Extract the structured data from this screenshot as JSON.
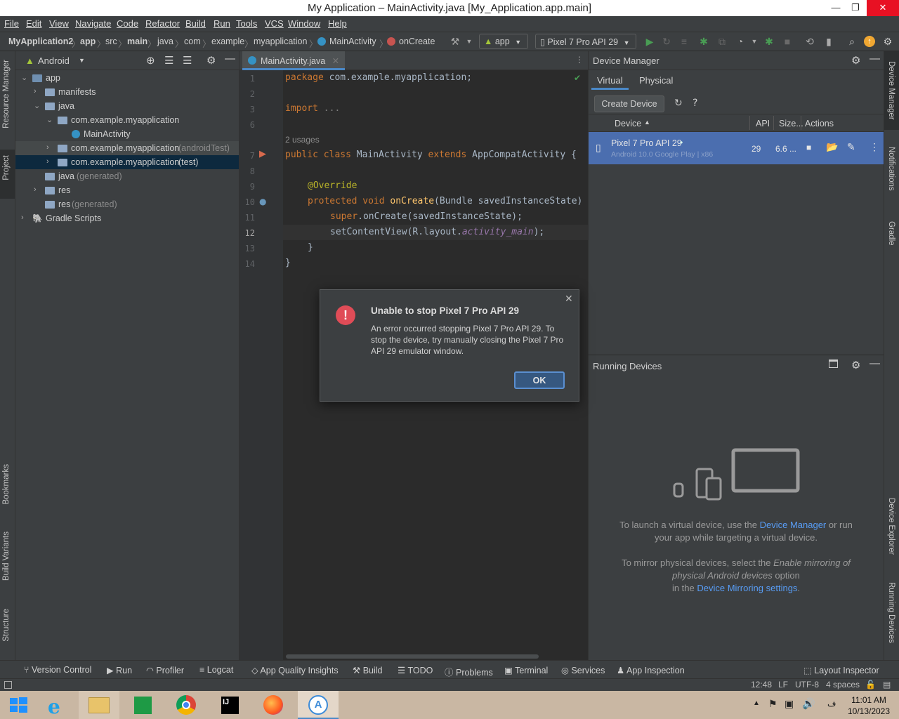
{
  "window": {
    "title": "My Application – MainActivity.java [My_Application.app.main]",
    "min": "—",
    "max": "❐",
    "close": "✕"
  },
  "menu": [
    "File",
    "Edit",
    "View",
    "Navigate",
    "Code",
    "Refactor",
    "Build",
    "Run",
    "Tools",
    "VCS",
    "Window",
    "Help"
  ],
  "breadcrumb": [
    "MyApplication2",
    "app",
    "src",
    "main",
    "java",
    "com",
    "example",
    "myapplication",
    "MainActivity",
    "onCreate"
  ],
  "toolbar": {
    "config": "app",
    "device": "Pixel 7 Pro API 29"
  },
  "left_strip": {
    "resource_manager": "Resource Manager",
    "project": "Project",
    "bookmarks": "Bookmarks",
    "build_variants": "Build Variants",
    "structure": "Structure"
  },
  "right_strip": {
    "device_manager": "Device Manager",
    "notifications": "Notifications",
    "gradle": "Gradle",
    "device_explorer": "Device Explorer",
    "running_devices": "Running Devices"
  },
  "project": {
    "view": "Android",
    "tree": [
      {
        "label": "app",
        "suffix": ""
      },
      {
        "label": "manifests",
        "suffix": ""
      },
      {
        "label": "java",
        "suffix": ""
      },
      {
        "label": "com.example.myapplication",
        "suffix": ""
      },
      {
        "label": "MainActivity",
        "suffix": ""
      },
      {
        "label": "com.example.myapplication",
        "suffix": "(androidTest)"
      },
      {
        "label": "com.example.myapplication",
        "suffix": "(test)"
      },
      {
        "label": "java",
        "suffix": "(generated)"
      },
      {
        "label": "res",
        "suffix": ""
      },
      {
        "label": "res",
        "suffix": "(generated)"
      },
      {
        "label": "Gradle Scripts",
        "suffix": ""
      }
    ]
  },
  "editor": {
    "tab": "MainActivity.java",
    "usages": "2 usages",
    "line_numbers": [
      "1",
      "2",
      "3",
      "6",
      "7",
      "8",
      "9",
      "10",
      "11",
      "12",
      "13",
      "14"
    ],
    "l1a": "package",
    "l1b": " com.example.myapplication;",
    "l3a": "import",
    "l3b": " ...",
    "l7a": "public class",
    "l7b": " MainActivity ",
    "l7c": "extends",
    "l7d": " AppCompatActivity {",
    "l9": "@Override",
    "l10a": "protected void ",
    "l10b": "onCreate",
    "l10c": "(Bundle savedInstanceState) {",
    "l11a": "super",
    "l11b": ".onCreate(savedInstanceState);",
    "l12a": "setContentView(R.layout.",
    "l12b": "activity_main",
    "l12c": ");",
    "l13": "}",
    "l14": "}"
  },
  "device_manager": {
    "title": "Device Manager",
    "tabs": [
      "Virtual",
      "Physical"
    ],
    "create_button": "Create Device",
    "help": "?",
    "columns": {
      "device": "Device",
      "api": "API",
      "size": "Size...",
      "actions": "Actions"
    },
    "row": {
      "name": "Pixel 7 Pro API 29",
      "dot": "•",
      "detail": "Android 10.0 Google Play | x86",
      "api": "29",
      "size": "6.6 ..."
    }
  },
  "running_devices": {
    "title": "Running Devices",
    "msg1_a": "To launch a virtual device, use the ",
    "msg1_link": "Device Manager",
    "msg1_b": " or run",
    "msg1_c": "your app while targeting a virtual device.",
    "msg2_a": "To mirror physical devices, select the ",
    "msg2_it1": "Enable mirroring of",
    "msg2_it2": "physical Android devices",
    "msg2_b": " option",
    "msg2_c": "in the ",
    "msg2_link": "Device Mirroring settings",
    "msg2_d": "."
  },
  "dialog": {
    "title": "Unable to stop Pixel 7 Pro API 29",
    "line1": "An error occurred stopping Pixel 7 Pro API 29. To",
    "line2": "stop the device, try manually closing the Pixel 7 Pro",
    "line3": "API 29 emulator window.",
    "ok": "OK",
    "close": "✕"
  },
  "bottom_tools": [
    "Version Control",
    "Run",
    "Profiler",
    "Logcat",
    "App Quality Insights",
    "Build",
    "TODO",
    "Problems",
    "Terminal",
    "Services",
    "App Inspection",
    "Layout Inspector"
  ],
  "status": {
    "pos": "12:48",
    "lf": "LF",
    "enc": "UTF-8",
    "indent": "4 spaces"
  },
  "clock": {
    "time": "11:01 AM",
    "date": "10/13/2023"
  },
  "colors": {
    "accent": "#4a88c7",
    "selection": "#4b6eaf",
    "error": "#e04c57",
    "run_green": "#499c54"
  }
}
